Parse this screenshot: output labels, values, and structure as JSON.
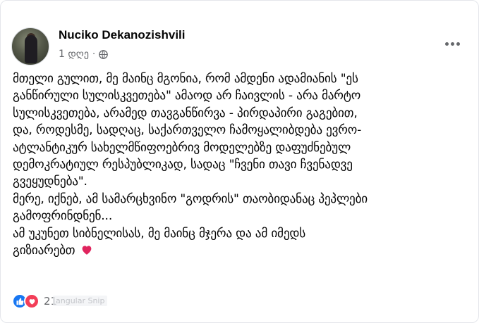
{
  "post": {
    "author": "Nuciko Dekanozishvili",
    "time": "1 დღე",
    "separator": "·",
    "privacy_icon": "globe-icon",
    "more_icon": "more-dots-icon",
    "lines": [
      "მთელი გულით, მე მაინც მგონია, რომ ამდენი ადამიანის \"ეს",
      "განწირული სულისკვეთება\" ამაოდ არ ჩაივლის - არა მარტო",
      "სულისკვეთება, არამედ თავგანწირვა - პირდაპირი გაგებით,",
      "და, როდესმე, სადღაც, საქართველო ჩამოყალიბდება ევრო-",
      "ატლანტიკურ სახელმწიფოებრივ მოდელებზე დაფუძნებულ",
      "დემოკრატიულ რესპუბლიკად, სადაც \"ჩვენი თავი ჩვენადვე",
      "გვეყუდნება\".",
      "მერე, იქნებ, ამ სამარცხვინო \"გოდრის\" თაობიდანაც პეპლები",
      "გამოფრინდნენ...",
      "ამ უკუნეთ სიბნელისას, მე მაინც მჯერა და ამ იმედს",
      "გიზიარებთ"
    ],
    "emoji": "red-heart-icon"
  },
  "reactions": {
    "icons": [
      "like-icon",
      "love-icon"
    ],
    "count": "21",
    "like_color": "#1877f2",
    "love_color": "#f33e58"
  },
  "overlay": {
    "snip_label": "angular Snip"
  }
}
